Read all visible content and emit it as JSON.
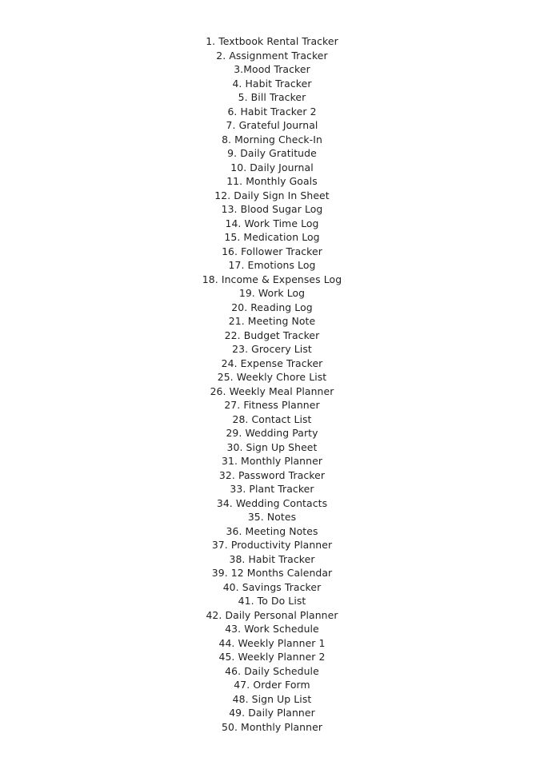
{
  "document": {
    "items": [
      "1. Textbook Rental Tracker",
      "2. Assignment Tracker",
      "3.Mood Tracker",
      "4. Habit Tracker",
      "5. Bill Tracker",
      "6. Habit Tracker 2",
      "7. Grateful Journal",
      "8. Morning Check-In",
      "9. Daily Gratitude",
      "10. Daily Journal",
      "11. Monthly Goals",
      "12. Daily Sign In Sheet",
      "13. Blood Sugar Log",
      "14. Work Time Log",
      "15. Medication Log",
      "16. Follower Tracker",
      "17. Emotions Log",
      "18. Income & Expenses Log",
      "19. Work Log",
      "20. Reading Log",
      "21. Meeting Note",
      "22. Budget Tracker",
      "23. Grocery List",
      "24. Expense Tracker",
      "25. Weekly Chore List",
      "26. Weekly Meal Planner",
      "27. Fitness Planner",
      "28. Contact List",
      "29. Wedding Party",
      "30. Sign Up Sheet",
      "31. Monthly Planner",
      "32. Password Tracker",
      "33. Plant Tracker",
      "34. Wedding Contacts",
      "35. Notes",
      "36. Meeting Notes",
      "37. Productivity Planner",
      "38. Habit Tracker",
      "39. 12 Months Calendar",
      "40. Savings Tracker",
      "41. To Do List",
      "42. Daily Personal Planner",
      "43. Work Schedule",
      "44. Weekly Planner 1",
      "45. Weekly Planner 2",
      "46. Daily Schedule",
      "47. Order Form",
      "48. Sign Up List",
      "49. Daily Planner",
      "50. Monthly Planner"
    ]
  }
}
